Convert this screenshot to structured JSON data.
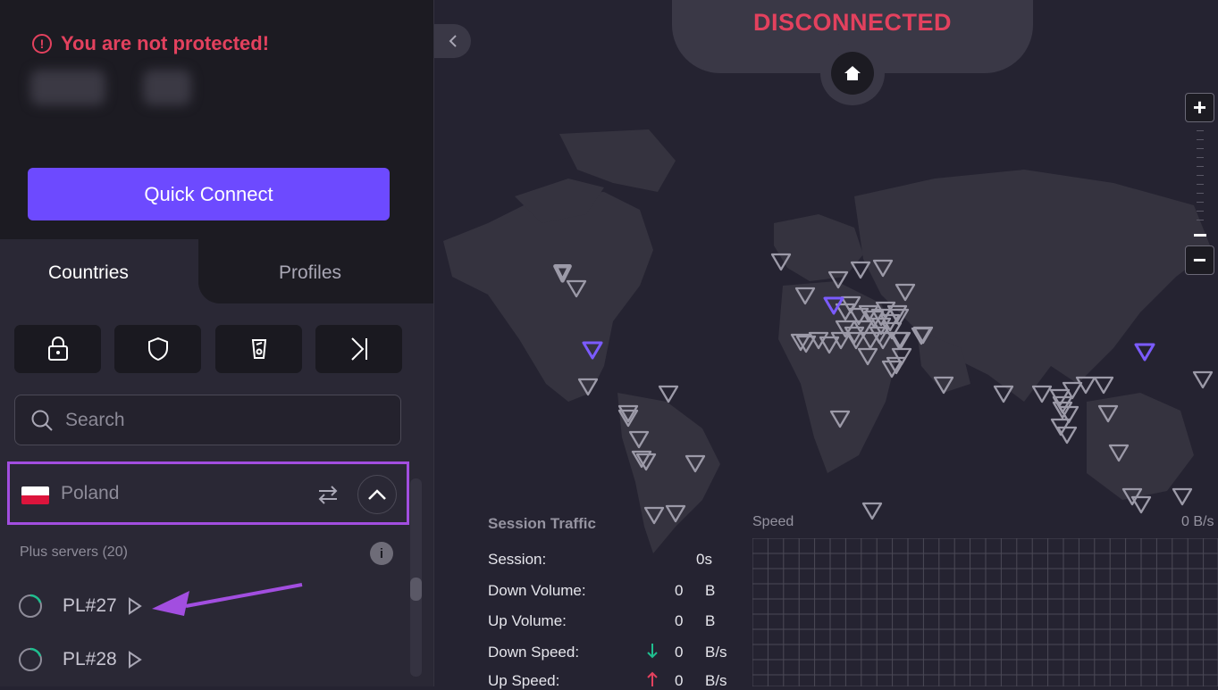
{
  "status": {
    "warning_text": "You are not protected!",
    "connection_state": "DISCONNECTED"
  },
  "sidebar": {
    "quick_connect_label": "Quick Connect",
    "tabs": [
      {
        "label": "Countries"
      },
      {
        "label": "Profiles"
      }
    ],
    "filters": [
      {
        "icon": "lock-icon"
      },
      {
        "icon": "shield-icon"
      },
      {
        "icon": "tor-onion-icon"
      },
      {
        "icon": "skip-forward-icon"
      }
    ],
    "search": {
      "placeholder": "Search"
    },
    "country": {
      "name": "Poland",
      "flag": "poland-flag"
    },
    "server_group": {
      "label": "Plus servers (20)"
    },
    "servers": [
      {
        "name": "PL#27"
      },
      {
        "name": "PL#28"
      }
    ]
  },
  "traffic": {
    "title": "Session Traffic",
    "rows": [
      {
        "label": "Session:",
        "value": "0s",
        "unit": ""
      },
      {
        "label": "Down Volume:",
        "value": "0",
        "unit": "B"
      },
      {
        "label": "Up Volume:",
        "value": "0",
        "unit": "B"
      },
      {
        "label": "Down Speed:",
        "value": "0",
        "unit": "B/s"
      },
      {
        "label": "Up Speed:",
        "value": "0",
        "unit": "B/s"
      }
    ],
    "speed_label": "Speed",
    "speed_unit": "0  B/s"
  },
  "colors": {
    "accent": "#6d4aff",
    "danger": "#e3415e",
    "highlight": "#a24ee0",
    "down_arrow": "#1fbf8f",
    "up_arrow": "#e3415e"
  }
}
